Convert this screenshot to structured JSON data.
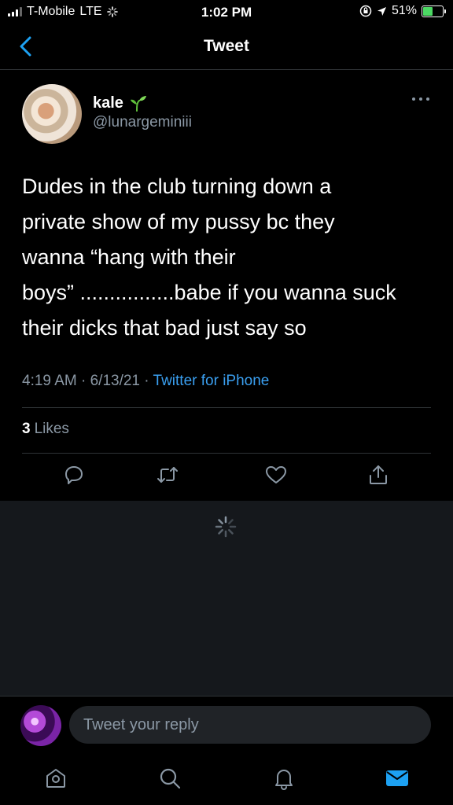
{
  "status_bar": {
    "carrier": "T-Mobile",
    "network": "LTE",
    "time": "1:02 PM",
    "battery": "51%"
  },
  "nav": {
    "title": "Tweet",
    "back_icon": "chevron-left-icon"
  },
  "tweet": {
    "author_name": "kale",
    "author_emoji": "🌱",
    "handle": "@lunargeminiii",
    "text": "Dudes in the club turning down a\nprivate show of my pussy bc they\nwanna “hang with their\nboys” ................babe if you wanna suck\ntheir dicks that bad just say so",
    "timestamp": "4:19 AM · 6/13/21 · ",
    "source": "Twitter for iPhone",
    "likes_count": "3",
    "likes_label": "Likes"
  },
  "reply": {
    "placeholder": "Tweet your reply"
  },
  "tabs": [
    "home-icon",
    "search-icon",
    "bell-icon",
    "mail-icon"
  ],
  "colors": {
    "background": "#000000",
    "accent": "#1da1f2",
    "link": "#3a9ff0",
    "muted": "#8b98a5",
    "divider": "#2f3336",
    "loading_bg": "#15181c"
  }
}
